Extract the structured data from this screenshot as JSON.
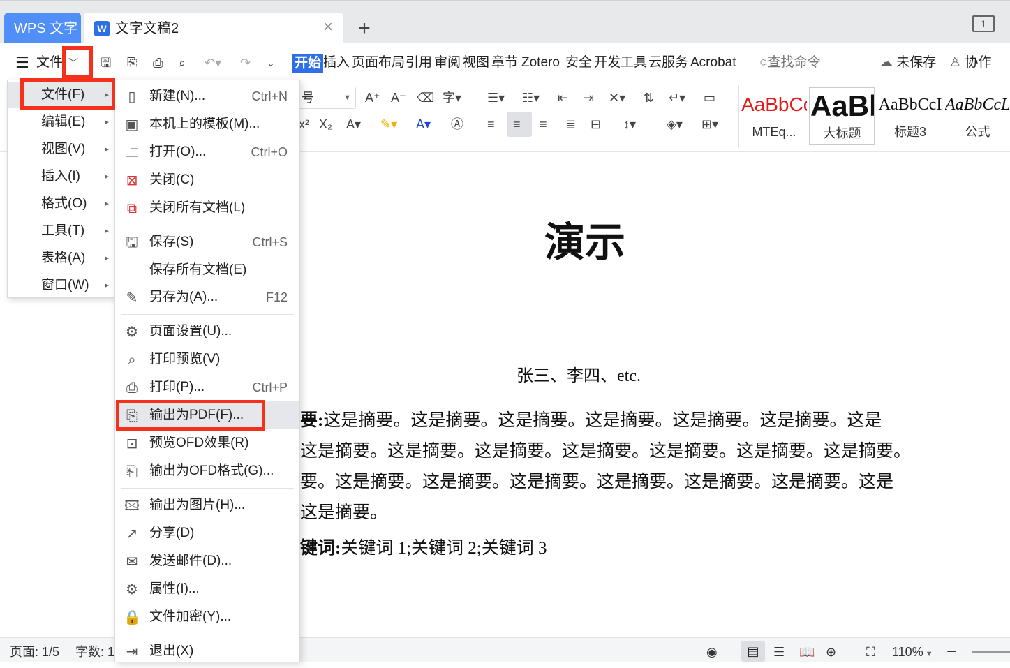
{
  "tabs": {
    "app_tab": "WPS 文字",
    "doc_tab": "文字文稿2",
    "close_glyph": "×",
    "add_glyph": "+",
    "pager": "1"
  },
  "toolbar": {
    "file_label": "文件",
    "menu_items": [
      "开始",
      "插入",
      "页面布局",
      "引用",
      "审阅",
      "视图",
      "章节",
      "Zotero",
      "安全",
      "开发工具",
      "云服务",
      "Acrobat"
    ],
    "search": "查找命令",
    "unsaved": "未保存",
    "collab": "协作"
  },
  "ribbon": {
    "font_field": "号",
    "styles": [
      {
        "sample": "AaBbCc",
        "name": "MTEq..."
      },
      {
        "sample": "AaBb",
        "name": "大标题"
      },
      {
        "sample": "AaBbCcI",
        "name": "标题3"
      },
      {
        "sample": "AaBbCcL",
        "name": "公式"
      }
    ]
  },
  "left_menu": [
    {
      "label": "文件(F)"
    },
    {
      "label": "编辑(E)"
    },
    {
      "label": "视图(V)"
    },
    {
      "label": "插入(I)"
    },
    {
      "label": "格式(O)"
    },
    {
      "label": "工具(T)"
    },
    {
      "label": "表格(A)"
    },
    {
      "label": "窗口(W)"
    }
  ],
  "file_menu": [
    {
      "label": "新建(N)...",
      "shortcut": "Ctrl+N"
    },
    {
      "label": "本机上的模板(M)...",
      "shortcut": ""
    },
    {
      "label": "打开(O)...",
      "shortcut": "Ctrl+O"
    },
    {
      "label": "关闭(C)",
      "shortcut": ""
    },
    {
      "label": "关闭所有文档(L)",
      "shortcut": ""
    },
    {
      "label": "保存(S)",
      "shortcut": "Ctrl+S"
    },
    {
      "label": "保存所有文档(E)",
      "shortcut": ""
    },
    {
      "label": "另存为(A)...",
      "shortcut": "F12"
    },
    {
      "label": "页面设置(U)...",
      "shortcut": ""
    },
    {
      "label": "打印预览(V)",
      "shortcut": ""
    },
    {
      "label": "打印(P)...",
      "shortcut": "Ctrl+P"
    },
    {
      "label": "输出为PDF(F)...",
      "shortcut": ""
    },
    {
      "label": "预览OFD效果(R)",
      "shortcut": ""
    },
    {
      "label": "输出为OFD格式(G)...",
      "shortcut": ""
    },
    {
      "label": "输出为图片(H)...",
      "shortcut": ""
    },
    {
      "label": "分享(D)",
      "shortcut": ""
    },
    {
      "label": "发送邮件(D)...",
      "shortcut": ""
    },
    {
      "label": "属性(I)...",
      "shortcut": ""
    },
    {
      "label": "文件加密(Y)...",
      "shortcut": ""
    },
    {
      "label": "退出(X)",
      "shortcut": ""
    }
  ],
  "document": {
    "title": "演示",
    "authors": "张三、李四、etc.",
    "abstract_label": "要:",
    "abstract_lines": [
      "这是摘要。这是摘要。这是摘要。这是摘要。这是摘要。这是摘要。这是",
      "这是摘要。这是摘要。这是摘要。这是摘要。这是摘要。这是摘要。这是摘要。",
      "要。这是摘要。这是摘要。这是摘要。这是摘要。这是摘要。这是摘要。这是",
      "这是摘要。"
    ],
    "keywords_label": "键词:",
    "keywords": "关键词 1;关键词 2;关键词 3"
  },
  "status": {
    "page": "页面: 1/5",
    "words": "字数: 1",
    "zoom": "110%"
  },
  "colors": {
    "accent": "#4f8ff7",
    "highlight": "#f5301b",
    "start_tab": "#2f6fe6"
  }
}
